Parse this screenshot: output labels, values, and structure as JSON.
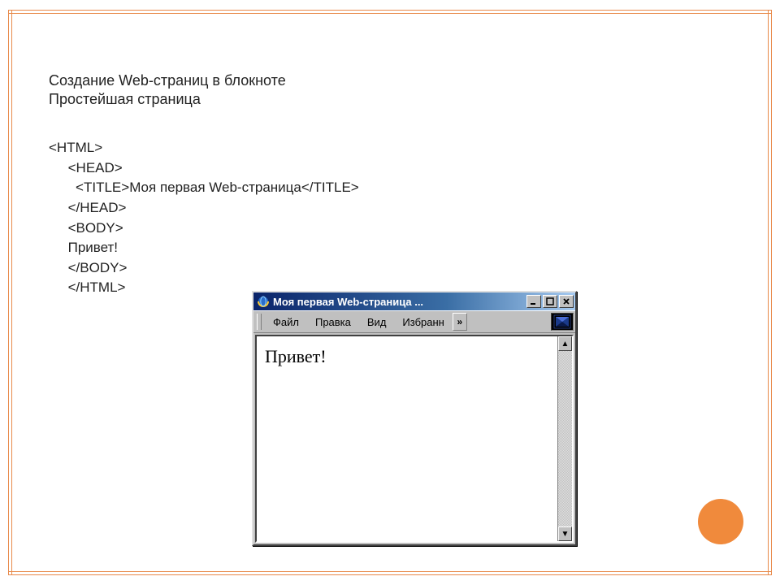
{
  "heading": {
    "line1": "Создание Web-страниц в блокноте",
    "line2": "Простейшая страница"
  },
  "code": {
    "l1": "<HTML>",
    "l2": "     <HEAD>",
    "l3": "       <TITLE>Моя первая Web-страница</TITLE>",
    "l4": "     </HEAD>",
    "l5": "     <BODY>",
    "l6": "     Привет!",
    "l7": "     </BODY>",
    "l8": "     </HTML>"
  },
  "browser": {
    "title": "Моя первая Web-страница ...",
    "menu": {
      "file": "Файл",
      "edit": "Правка",
      "view": "Вид",
      "favorites": "Избранн",
      "overflow": "»"
    },
    "page_text": "Привет!",
    "scroll_up": "▲",
    "scroll_down": "▼"
  }
}
